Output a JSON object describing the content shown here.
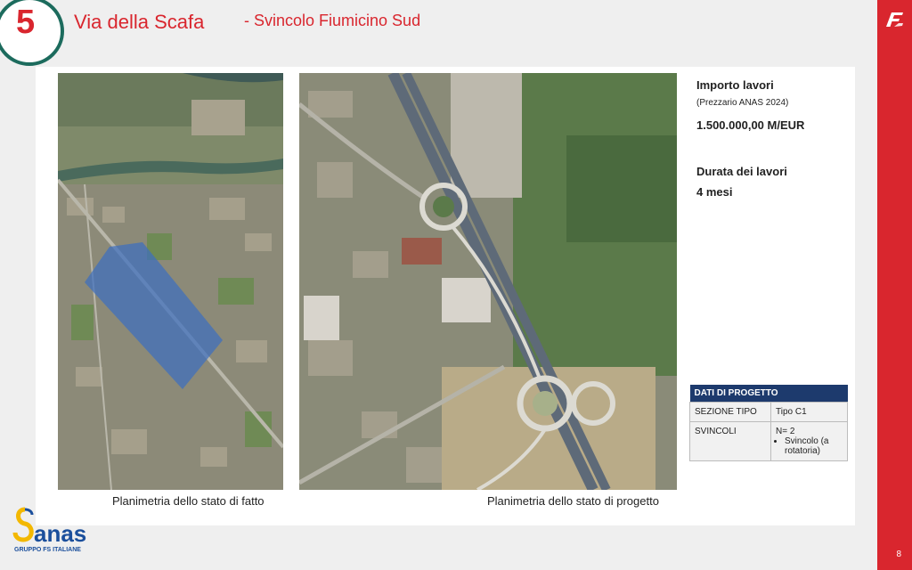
{
  "header": {
    "number": "5",
    "title": "Via della Scafa",
    "subtitle": "- Svincolo Fiumicino Sud"
  },
  "maps": {
    "left_caption": "Planimetria dello stato di fatto",
    "right_caption": "Planimetria dello stato di progetto"
  },
  "info": {
    "importo_label": "Importo lavori",
    "prezzario": "(Prezzario ANAS 2024)",
    "importo_value": "1.500.000,00 M/EUR",
    "durata_label": "Durata dei lavori",
    "durata_value": "4 mesi"
  },
  "table": {
    "header": "DATI DI PROGETTO",
    "rows": [
      {
        "label": "SEZIONE TIPO",
        "value": "Tipo C1"
      },
      {
        "label": "SVINCOLI",
        "value": "N= 2",
        "bullet": "Svincolo (a rotatoria)"
      }
    ]
  },
  "logo": {
    "brand": "anas",
    "tagline": "GRUPPO FS ITALIANE"
  },
  "page_number": "8",
  "colors": {
    "accent_red": "#d9262e",
    "circle_green": "#1c6b5d",
    "table_header": "#1d3a6d",
    "anas_yellow": "#f3b800",
    "anas_blue": "#1b4f9c"
  },
  "icons": {
    "fs_logo": "fs-italiane-logo-icon"
  }
}
